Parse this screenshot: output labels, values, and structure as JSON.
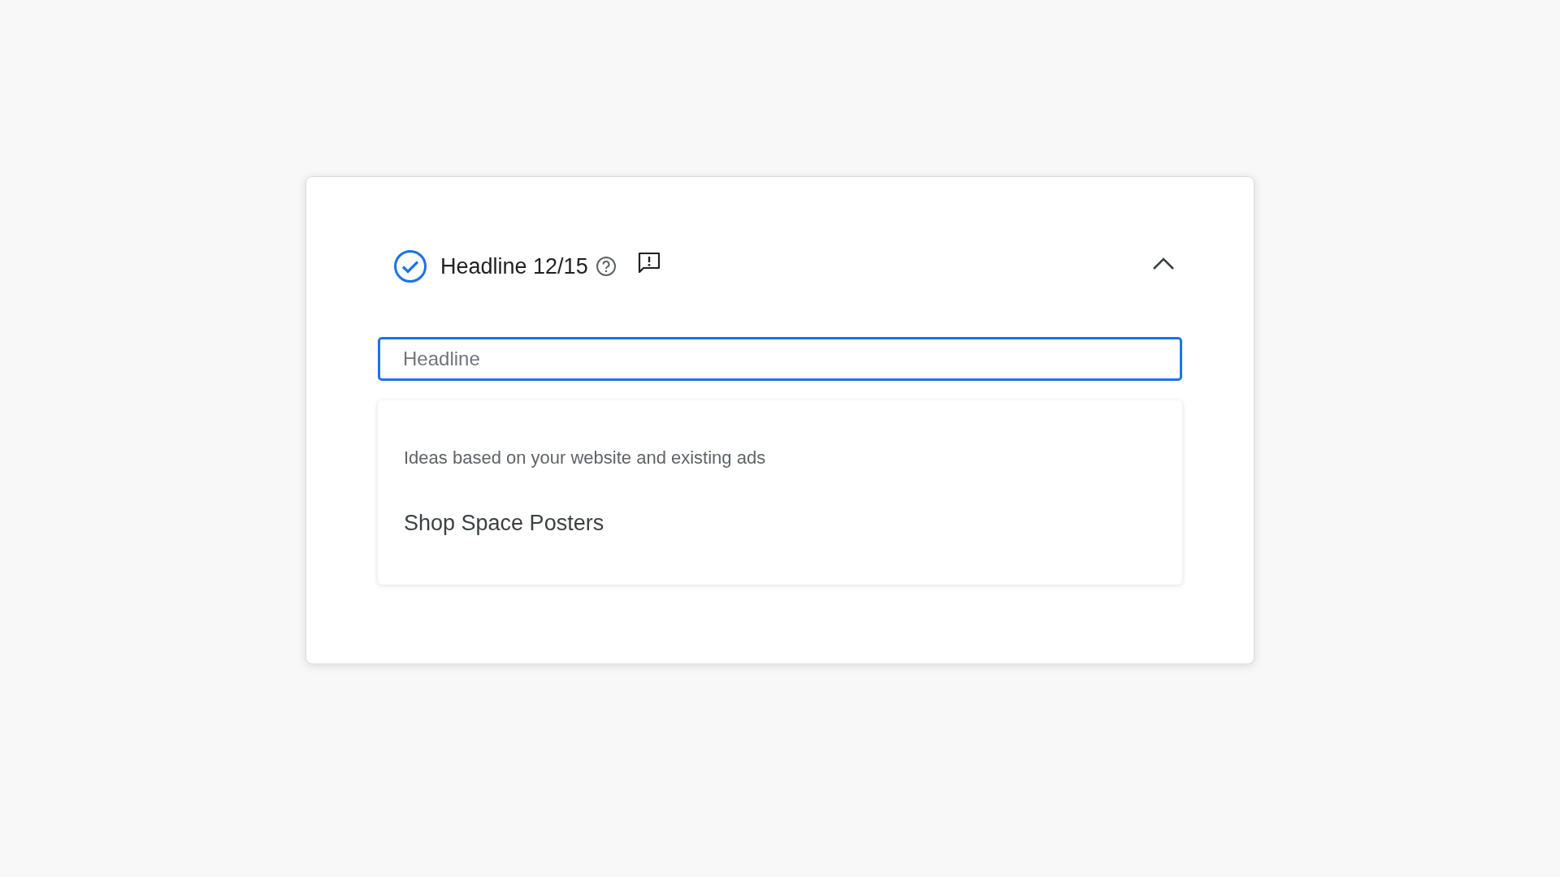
{
  "section": {
    "title": "Headline 12/15",
    "complete": true,
    "expanded": true
  },
  "field": {
    "placeholder": "Headline",
    "focused": true
  },
  "suggestions": {
    "hint": "Ideas based on your website and existing ads",
    "items": [
      {
        "label": "Shop Space Posters"
      }
    ]
  }
}
